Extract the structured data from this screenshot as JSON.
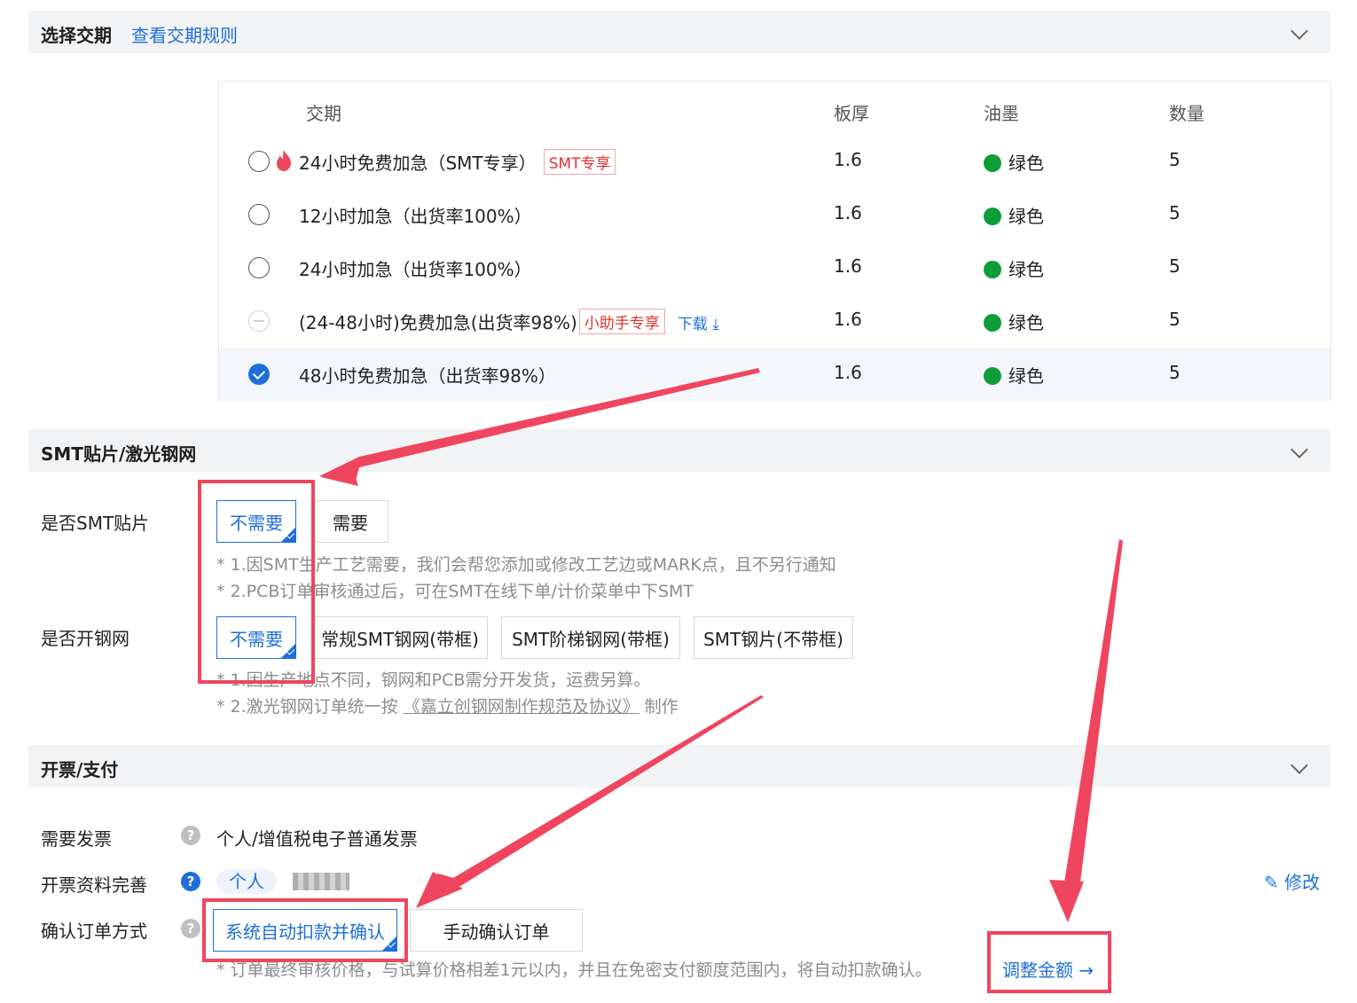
{
  "section1": {
    "title": "选择交期",
    "link": "查看交期规则",
    "table": {
      "headers": [
        "交期",
        "板厚",
        "油墨",
        "数量"
      ],
      "rows": [
        {
          "label": "24小时免费加急（SMT专享）",
          "tag": "SMT专享",
          "thickness": "1.6",
          "ink": "绿色",
          "qty": "5",
          "state": "unchecked",
          "icon": "fire-icon"
        },
        {
          "label": "12小时加急（出货率100%）",
          "thickness": "1.6",
          "ink": "绿色",
          "qty": "5",
          "state": "unchecked"
        },
        {
          "label": "24小时加急（出货率100%）",
          "thickness": "1.6",
          "ink": "绿色",
          "qty": "5",
          "state": "unchecked"
        },
        {
          "label": "(24-48小时)免费加急(出货率98%)",
          "tag": "小助手专享",
          "link": "下载",
          "link_icon": "download-icon",
          "thickness": "1.6",
          "ink": "绿色",
          "qty": "5",
          "state": "disabled"
        },
        {
          "label": "48小时免费加急（出货率98%）",
          "thickness": "1.6",
          "ink": "绿色",
          "qty": "5",
          "state": "checked"
        }
      ]
    }
  },
  "section2": {
    "title": "SMT贴片/激光钢网",
    "smt": {
      "label": "是否SMT贴片",
      "options": [
        "不需要",
        "需要"
      ],
      "selected": "不需要",
      "notes": [
        "* 1.因SMT生产工艺需要，我们会帮您添加或修改工艺边或MARK点，且不另行通知",
        "* 2.PCB订单审核通过后，可在SMT在线下单/计价菜单中下SMT"
      ]
    },
    "stencil": {
      "label": "是否开钢网",
      "options": [
        "不需要",
        "常规SMT钢网(带框)",
        "SMT阶梯钢网(带框)",
        "SMT钢片(不带框)"
      ],
      "selected": "不需要",
      "note1": "* 1.因生产地点不同，钢网和PCB需分开发货，运费另算。",
      "note2_prefix": "* 2.激光钢网订单统一按 ",
      "note2_link": "《嘉立创钢网制作规范及协议》",
      "note2_suffix": " 制作"
    }
  },
  "section3": {
    "title": "开票/支付",
    "invoice": {
      "label": "需要发票",
      "value": "个人/增值税电子普通发票"
    },
    "info": {
      "label": "开票资料完善",
      "pill": "个人",
      "edit": "修改"
    },
    "confirm": {
      "label": "确认订单方式",
      "options": [
        "系统自动扣款并确认",
        "手动确认订单"
      ],
      "selected": "系统自动扣款并确认",
      "note": "* 订单最终审核价格，与试算价格相差1元以内，并且在免密支付额度范围内，将自动扣款确认。",
      "adjust": "调整金额 →"
    }
  },
  "colors": {
    "accent": "#1e6fd9",
    "highlight": "#f0455f",
    "ink_green": "#0f9d3a",
    "header_bg": "#f2f3f5"
  }
}
